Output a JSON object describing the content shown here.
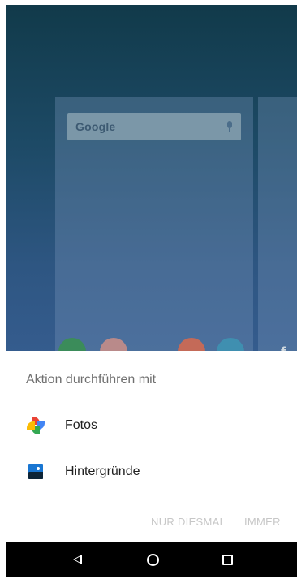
{
  "launcher": {
    "search_logo_text": "Google",
    "dock_icons": [
      "chrome-icon",
      "maps-icon",
      "play-store-icon"
    ],
    "peek_letter": "f"
  },
  "chooser": {
    "title": "Aktion durchführen mit",
    "options": [
      {
        "label": "Fotos",
        "icon": "photos-pinwheel-icon"
      },
      {
        "label": "Hintergründe",
        "icon": "wallpapers-icon"
      }
    ],
    "just_once_label": "NUR DIESMAL",
    "always_label": "IMMER"
  },
  "navbar": {
    "back": "back-triangle-icon",
    "home": "home-circle-icon",
    "recents": "recents-square-icon"
  }
}
